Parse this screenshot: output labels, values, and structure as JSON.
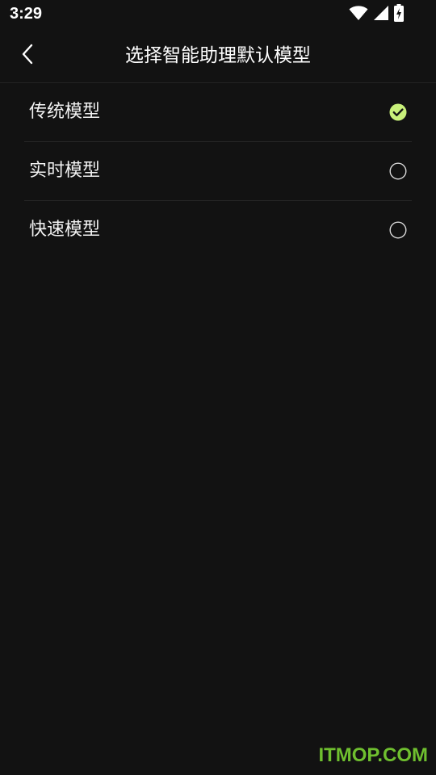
{
  "status_bar": {
    "time": "3:29",
    "icons": [
      "wifi-icon",
      "cell-signal-icon",
      "battery-charging-icon"
    ]
  },
  "app_bar": {
    "back_icon": "chevron-left-icon",
    "title": "选择智能助理默认模型"
  },
  "options": [
    {
      "label": "传统模型",
      "selected": true
    },
    {
      "label": "实时模型",
      "selected": false
    },
    {
      "label": "快速模型",
      "selected": false
    }
  ],
  "colors": {
    "background": "#121212",
    "selected_accent": "#c8f07a",
    "watermark": "#6fbf2f"
  },
  "watermark": {
    "text": "ITMOP.COM"
  }
}
